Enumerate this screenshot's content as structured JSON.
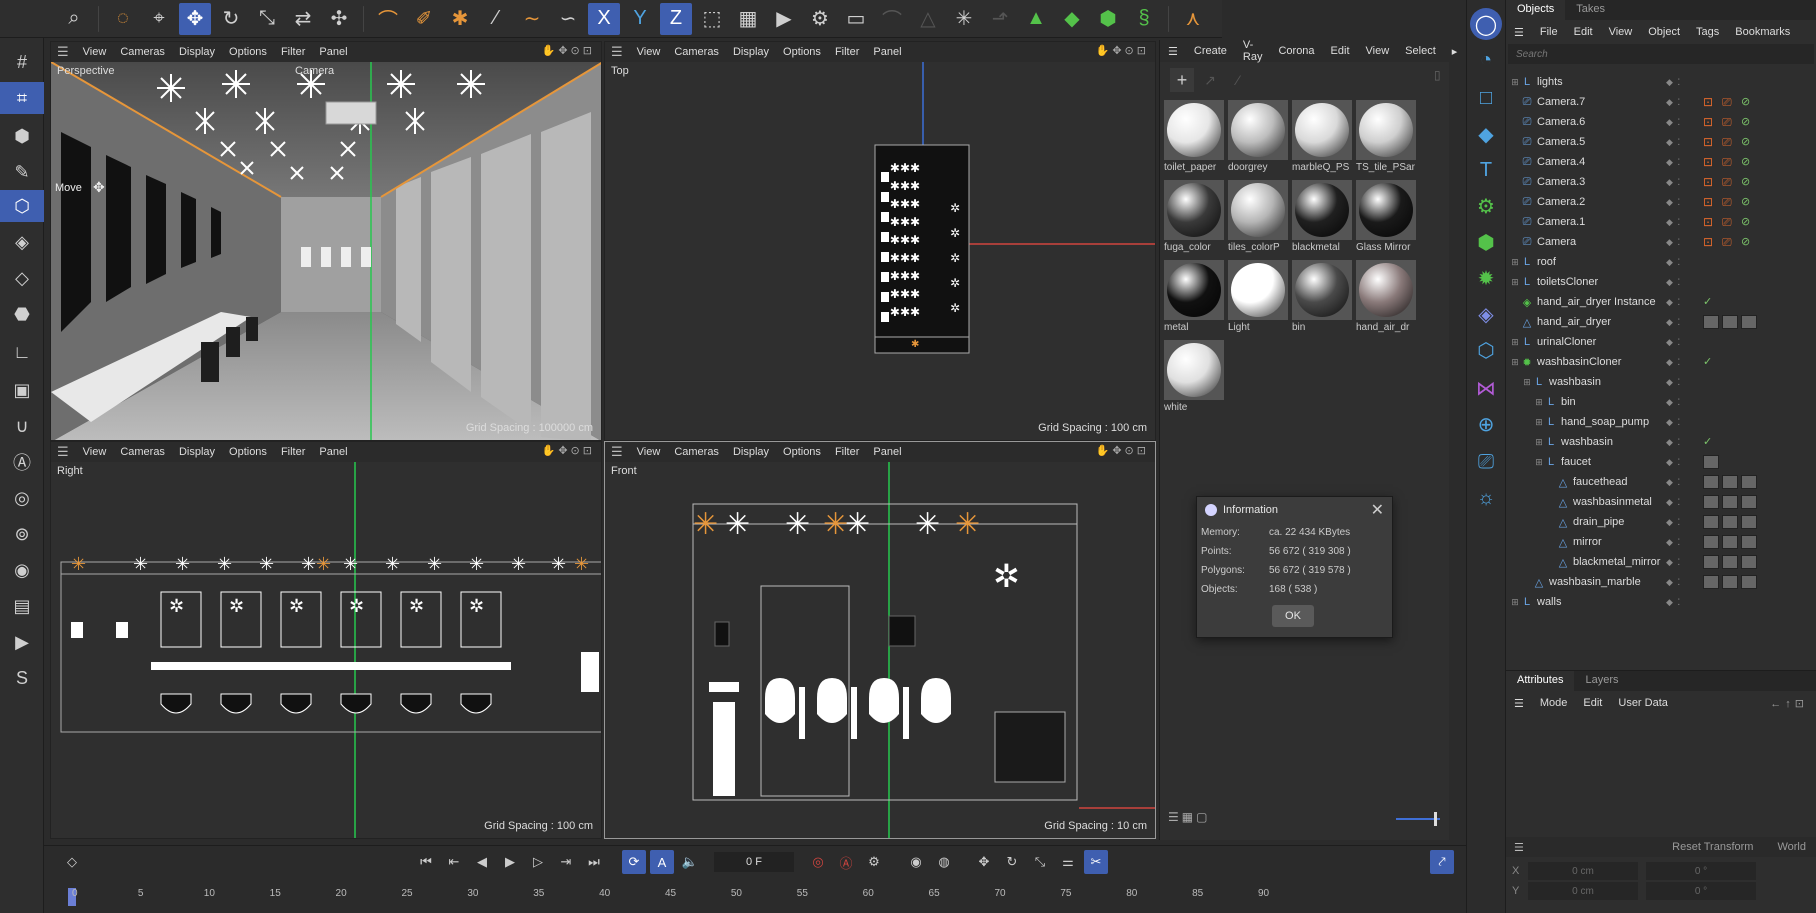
{
  "viewports": {
    "menu": [
      "View",
      "Cameras",
      "Display",
      "Options",
      "Filter",
      "Panel"
    ],
    "perspective": {
      "name": "Perspective",
      "camera": "Camera",
      "tool_label": "Move",
      "grid": "Grid Spacing : 100000 cm"
    },
    "top": {
      "name": "Top",
      "grid": "Grid Spacing : 100 cm"
    },
    "right": {
      "name": "Right",
      "grid": "Grid Spacing : 100 cm"
    },
    "front": {
      "name": "Front",
      "grid": "Grid Spacing : 10 cm"
    }
  },
  "material_manager": {
    "menu": [
      "Create",
      "V-Ray",
      "Corona",
      "Edit",
      "View",
      "Select"
    ],
    "materials": [
      {
        "name": "toilet_paper",
        "color": "#e6e6e6"
      },
      {
        "name": "doorgrey",
        "color": "#bdbdbd"
      },
      {
        "name": "marbleQ_PS",
        "color": "#d9d9d9"
      },
      {
        "name": "TS_tile_PSar",
        "color": "#cfcfcf"
      },
      {
        "name": "fuga_color",
        "color": "#3a3a3a"
      },
      {
        "name": "tiles_colorP",
        "color": "#b5b5b5"
      },
      {
        "name": "blackmetal",
        "color": "#202020"
      },
      {
        "name": "Glass Mirror",
        "color": "#1a1a1a"
      },
      {
        "name": "metal",
        "color": "#111111"
      },
      {
        "name": "Light",
        "color": "#ffffff"
      },
      {
        "name": "bin",
        "color": "#4a4a4a"
      },
      {
        "name": "hand_air_dr",
        "color": "#8a7a7a"
      },
      {
        "name": "white",
        "color": "#e0e0e0"
      }
    ]
  },
  "info_dialog": {
    "title": "Information",
    "rows": [
      {
        "k": "Memory:",
        "v": "ca. 22 434 KBytes"
      },
      {
        "k": "Points:",
        "v": "56 672 ( 319 308 )"
      },
      {
        "k": "Polygons:",
        "v": "56 672 ( 319 578 )"
      },
      {
        "k": "Objects:",
        "v": "168 ( 538 )"
      }
    ],
    "ok": "OK"
  },
  "objects_manager": {
    "tabs": [
      "Objects",
      "Takes"
    ],
    "menu": [
      "File",
      "Edit",
      "View",
      "Object",
      "Tags",
      "Bookmarks"
    ],
    "search_placeholder": "Search",
    "items": [
      {
        "name": "lights",
        "depth": 0,
        "icon": "null",
        "tags": ""
      },
      {
        "name": "Camera.7",
        "depth": 0,
        "icon": "camera",
        "tags": "cam"
      },
      {
        "name": "Camera.6",
        "depth": 0,
        "icon": "camera",
        "tags": "cam"
      },
      {
        "name": "Camera.5",
        "depth": 0,
        "icon": "camera",
        "tags": "cam"
      },
      {
        "name": "Camera.4",
        "depth": 0,
        "icon": "camera",
        "tags": "cam"
      },
      {
        "name": "Camera.3",
        "depth": 0,
        "icon": "camera",
        "tags": "cam"
      },
      {
        "name": "Camera.2",
        "depth": 0,
        "icon": "camera",
        "tags": "cam"
      },
      {
        "name": "Camera.1",
        "depth": 0,
        "icon": "camera",
        "tags": "cam"
      },
      {
        "name": "Camera",
        "depth": 0,
        "icon": "camera",
        "tags": "cam"
      },
      {
        "name": "roof",
        "depth": 0,
        "icon": "null",
        "tags": ""
      },
      {
        "name": "toiletsCloner",
        "depth": 0,
        "icon": "null",
        "tags": ""
      },
      {
        "name": "hand_air_dryer Instance",
        "depth": 0,
        "icon": "instance",
        "tags": "chk"
      },
      {
        "name": "hand_air_dryer",
        "depth": 0,
        "icon": "poly",
        "tags": "mat3"
      },
      {
        "name": "urinalCloner",
        "depth": 0,
        "icon": "null",
        "tags": ""
      },
      {
        "name": "washbasinCloner",
        "depth": 0,
        "icon": "cloner",
        "tags": "chk"
      },
      {
        "name": "washbasin",
        "depth": 1,
        "icon": "null",
        "tags": ""
      },
      {
        "name": "bin",
        "depth": 2,
        "icon": "null",
        "tags": ""
      },
      {
        "name": "hand_soap_pump",
        "depth": 2,
        "icon": "null",
        "tags": ""
      },
      {
        "name": "washbasin",
        "depth": 2,
        "icon": "null",
        "tags": "chk"
      },
      {
        "name": "faucet",
        "depth": 2,
        "icon": "null",
        "tags": "mat1"
      },
      {
        "name": "faucethead",
        "depth": 3,
        "icon": "poly",
        "tags": "mat3"
      },
      {
        "name": "washbasinmetal",
        "depth": 3,
        "icon": "poly",
        "tags": "mat3"
      },
      {
        "name": "drain_pipe",
        "depth": 3,
        "icon": "poly",
        "tags": "mat3"
      },
      {
        "name": "mirror",
        "depth": 3,
        "icon": "poly",
        "tags": "mat3"
      },
      {
        "name": "blackmetal_mirror",
        "depth": 3,
        "icon": "poly",
        "tags": "mat3"
      },
      {
        "name": "washbasin_marble",
        "depth": 1,
        "icon": "poly",
        "tags": "mat3"
      },
      {
        "name": "walls",
        "depth": 0,
        "icon": "null",
        "tags": ""
      }
    ]
  },
  "attributes": {
    "tabs": [
      "Attributes",
      "Layers"
    ],
    "menu": [
      "Mode",
      "Edit",
      "User Data"
    ],
    "reset": "Reset Transform",
    "space": "World",
    "rows": [
      {
        "axis": "X",
        "pos": "0 cm",
        "rot": "0 °"
      },
      {
        "axis": "Y",
        "pos": "0 cm",
        "rot": "0 °"
      }
    ]
  },
  "timeline": {
    "frame": "0 F",
    "ticks": [
      "0",
      "5",
      "10",
      "15",
      "20",
      "25",
      "30",
      "35",
      "40",
      "45",
      "50",
      "55",
      "60",
      "65",
      "70",
      "75",
      "80",
      "85",
      "90"
    ]
  }
}
